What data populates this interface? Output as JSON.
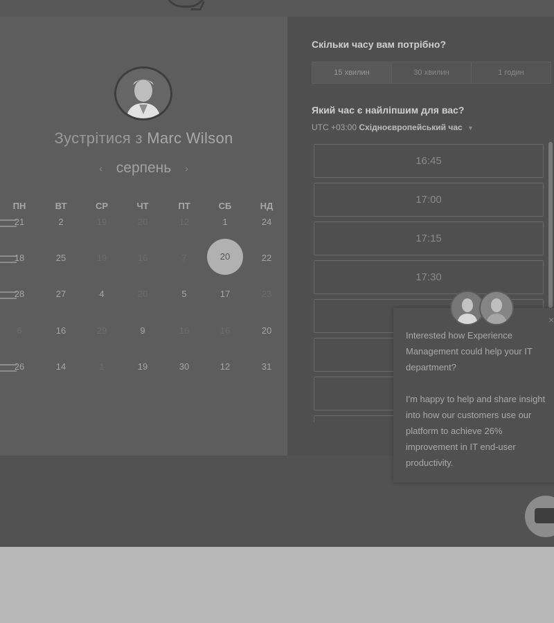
{
  "booking": {
    "meet_prefix": "Зустрітися з",
    "host_name": "Marc Wilson",
    "month": "серпень",
    "weekdays": [
      "ПН",
      "ВТ",
      "СР",
      "ЧТ",
      "ПТ",
      "СБ",
      "НД"
    ],
    "weeks": [
      [
        {
          "d": "21",
          "m": false
        },
        {
          "d": "2",
          "m": false
        },
        {
          "d": "19",
          "m": true
        },
        {
          "d": "20",
          "m": true
        },
        {
          "d": "12",
          "m": true
        },
        {
          "d": "1",
          "m": false
        },
        {
          "d": "24",
          "m": false
        }
      ],
      [
        {
          "d": "18",
          "m": false
        },
        {
          "d": "25",
          "m": false
        },
        {
          "d": "19",
          "m": true
        },
        {
          "d": "16",
          "m": true
        },
        {
          "d": "7",
          "m": true
        },
        {
          "d": "20",
          "m": false,
          "selected": true
        },
        {
          "d": "22",
          "m": false
        }
      ],
      [
        {
          "d": "28",
          "m": false
        },
        {
          "d": "27",
          "m": false
        },
        {
          "d": "4",
          "m": false
        },
        {
          "d": "20",
          "m": true
        },
        {
          "d": "5",
          "m": false
        },
        {
          "d": "17",
          "m": false
        },
        {
          "d": "23",
          "m": true
        }
      ],
      [
        {
          "d": "6",
          "m": true
        },
        {
          "d": "16",
          "m": false
        },
        {
          "d": "29",
          "m": true
        },
        {
          "d": "9",
          "m": false
        },
        {
          "d": "16",
          "m": true
        },
        {
          "d": "16",
          "m": true
        },
        {
          "d": "20",
          "m": false
        }
      ],
      [
        {
          "d": "26",
          "m": false
        },
        {
          "d": "14",
          "m": false
        },
        {
          "d": "1",
          "m": true
        },
        {
          "d": "19",
          "m": false
        },
        {
          "d": "30",
          "m": false
        },
        {
          "d": "12",
          "m": false
        },
        {
          "d": "31",
          "m": false
        }
      ]
    ]
  },
  "schedule": {
    "duration_question": "Скільки часу вам потрібно?",
    "durations": [
      "15 хвилин",
      "30 хвилин",
      "1 годин"
    ],
    "time_question": "Який час є найліпшим для вас?",
    "timezone_offset": "UTC +03:00",
    "timezone_name": "Східноєвропейський час",
    "slots": [
      "16:45",
      "17:00",
      "17:15",
      "17:30",
      "",
      "",
      "",
      ""
    ]
  },
  "chat": {
    "message_p1": "Interested how Experience Management could help your IT department?",
    "message_p2": "I'm happy to help and share insight into how our customers use our platform to achieve 26% improvement in IT end-user productivity.",
    "close_glyph": "×"
  }
}
